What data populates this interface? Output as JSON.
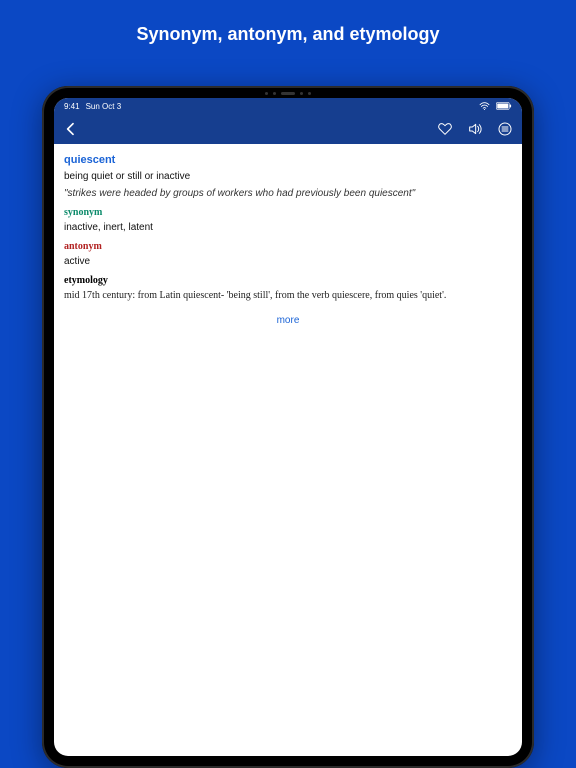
{
  "promo": {
    "title": "Synonym, antonym, and etymology"
  },
  "status": {
    "time": "9:41",
    "date": "Sun Oct 3"
  },
  "entry": {
    "headword": "quiescent",
    "definition": "being quiet or still or inactive",
    "example": "\"strikes were headed by groups of workers who had previously been quiescent\"",
    "synonym_label": "synonym",
    "synonyms": "inactive, inert, latent",
    "antonym_label": "antonym",
    "antonyms": "active",
    "etymology_label": "etymology",
    "etymology": "mid 17th century: from Latin quiescent- 'being still', from the verb quiescere, from quies 'quiet'."
  },
  "actions": {
    "more": "more"
  }
}
